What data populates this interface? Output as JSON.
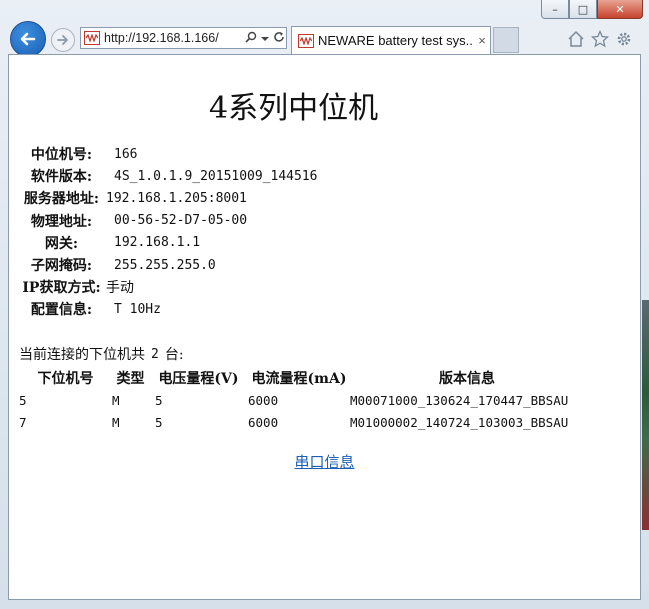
{
  "browser": {
    "address": "http://192.168.1.166/",
    "tab_title": "NEWARE battery test sys...",
    "tab_close": "×",
    "win_controls": [
      "–",
      "□",
      "✕"
    ]
  },
  "page": {
    "title": "4系列中位机",
    "info": [
      {
        "label": "中位机号:",
        "value": "166"
      },
      {
        "label": "软件版本:",
        "value": "4S_1.0.1.9_20151009_144516"
      },
      {
        "label": "服务器地址:",
        "value": "192.168.1.205:8001"
      },
      {
        "label": "物理地址:",
        "value": "00-56-52-D7-05-00"
      },
      {
        "label": "网关:",
        "value": "192.168.1.1"
      },
      {
        "label": "子网掩码:",
        "value": "255.255.255.0"
      },
      {
        "label": "IP获取方式:",
        "value": "手动"
      },
      {
        "label": "配置信息:",
        "value": "T 10Hz"
      }
    ],
    "summary": {
      "prefix": "当前连接的下位机共",
      "count": "2",
      "suffix": "台:"
    },
    "table": {
      "headers": [
        "下位机号",
        "类型",
        "电压量程(V)",
        "电流量程(mA)",
        "版本信息"
      ],
      "rows": [
        [
          "5",
          "M",
          "5",
          "6000",
          "M00071000_130624_170447_BBSAU"
        ],
        [
          "7",
          "M",
          "5",
          "6000",
          "M01000002_140724_103003_BBSAU"
        ]
      ]
    },
    "serial_link": "串口信息"
  }
}
